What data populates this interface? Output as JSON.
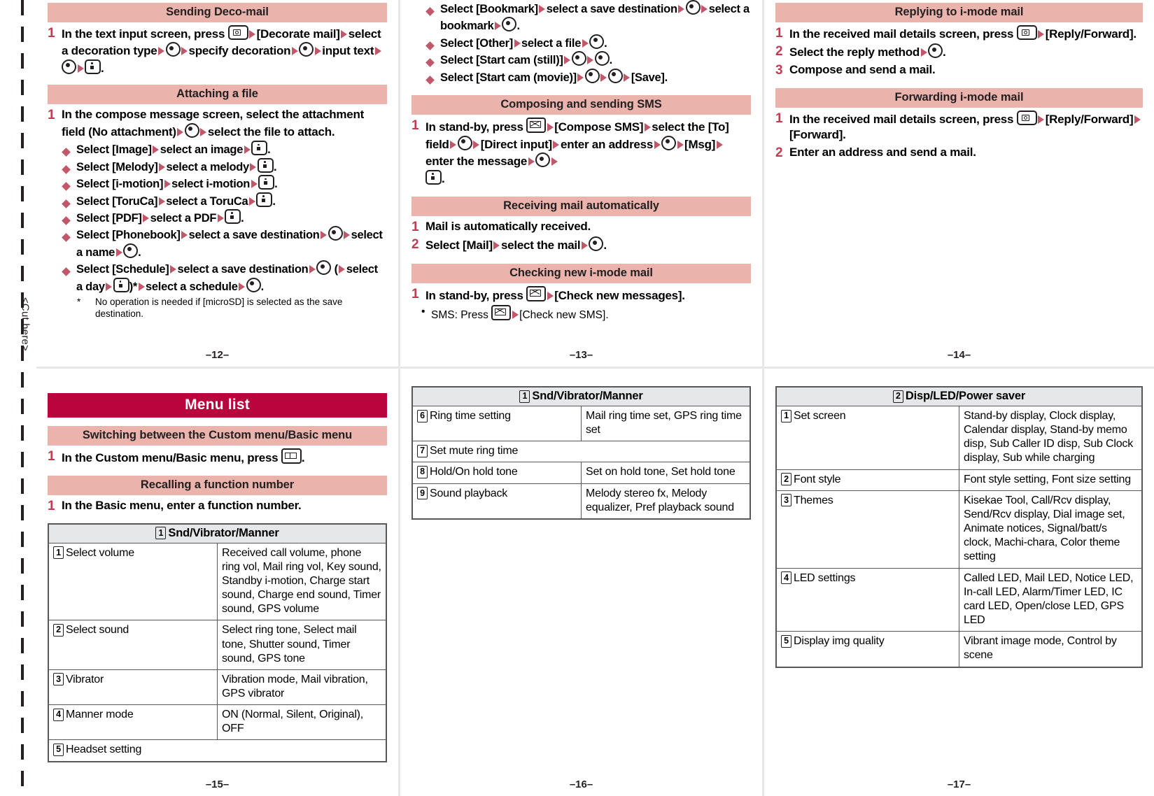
{
  "cut_label": "<Cut here>",
  "icons": {
    "camera_key": "camera-key-icon",
    "i_key": "i-mode-key-icon",
    "mail_key": "mail-key-icon",
    "book_key": "book-key-icon",
    "center_key": "center-select-key-icon",
    "arrow": "arrow-right-icon",
    "diamond": "diamond-bullet-icon"
  },
  "pages": {
    "p12": {
      "folio": "–12–",
      "sections": [
        {
          "title": "Sending Deco-mail",
          "steps": [
            {
              "num": "1",
              "parts": [
                {
                  "t": "In the text input screen, press "
                },
                {
                  "k": "cam"
                },
                {
                  "a": 1
                },
                {
                  "t": "[Decorate mail]"
                },
                {
                  "a": 1
                },
                {
                  "t": "select a decoration type"
                },
                {
                  "a": 1
                },
                {
                  "c": 1
                },
                {
                  "a": 1
                },
                {
                  "t": "specify decoration"
                },
                {
                  "a": 1
                },
                {
                  "c": 1
                },
                {
                  "a": 1
                },
                {
                  "t": "input text"
                },
                {
                  "a": 1
                },
                {
                  "c": 1
                },
                {
                  "a": 1
                },
                {
                  "k": "i"
                },
                {
                  "t": "."
                }
              ]
            }
          ]
        },
        {
          "title": "Attaching a file",
          "steps": [
            {
              "num": "1",
              "parts": [
                {
                  "t": "In the compose message screen, select the attachment field (No attachment)"
                },
                {
                  "a": 1
                },
                {
                  "c": 1
                },
                {
                  "a": 1
                },
                {
                  "t": "select the file to attach."
                }
              ]
            }
          ],
          "bullets": [
            [
              {
                "t": "Select [Image]"
              },
              {
                "a": 1
              },
              {
                "t": "select an image"
              },
              {
                "a": 1
              },
              {
                "k": "i"
              },
              {
                "t": "."
              }
            ],
            [
              {
                "t": "Select [Melody]"
              },
              {
                "a": 1
              },
              {
                "t": "select a melody"
              },
              {
                "a": 1
              },
              {
                "k": "i"
              },
              {
                "t": "."
              }
            ],
            [
              {
                "t": "Select [i-motion]"
              },
              {
                "a": 1
              },
              {
                "t": "select i-motion"
              },
              {
                "a": 1
              },
              {
                "k": "i"
              },
              {
                "t": "."
              }
            ],
            [
              {
                "t": "Select [ToruCa]"
              },
              {
                "a": 1
              },
              {
                "t": "select a ToruCa"
              },
              {
                "a": 1
              },
              {
                "k": "i"
              },
              {
                "t": "."
              }
            ],
            [
              {
                "t": "Select [PDF]"
              },
              {
                "a": 1
              },
              {
                "t": "select a PDF"
              },
              {
                "a": 1
              },
              {
                "k": "i"
              },
              {
                "t": "."
              }
            ],
            [
              {
                "t": "Select [Phonebook]"
              },
              {
                "a": 1
              },
              {
                "t": "select a save destination"
              },
              {
                "a": 1
              },
              {
                "c": 1
              },
              {
                "a": 1
              },
              {
                "t": "select a name"
              },
              {
                "a": 1
              },
              {
                "c": 1
              },
              {
                "t": "."
              }
            ],
            [
              {
                "t": "Select [Schedule]"
              },
              {
                "a": 1
              },
              {
                "t": "select a save destination"
              },
              {
                "a": 1
              },
              {
                "c": 1
              },
              {
                "t": "("
              },
              {
                "a": 1
              },
              {
                "t": "select a day"
              },
              {
                "a": 1
              },
              {
                "k": "i"
              },
              {
                "t": ")*"
              },
              {
                "a": 1
              },
              {
                "t": "select a schedule"
              },
              {
                "a": 1
              },
              {
                "c": 1
              },
              {
                "t": "."
              }
            ]
          ],
          "footnote": {
            "mark": "*",
            "text": "No operation is needed if [microSD] is selected as the save destination."
          }
        }
      ]
    },
    "p13": {
      "folio": "–13–",
      "carryover_bullets": [
        [
          {
            "t": "Select [Bookmark]"
          },
          {
            "a": 1
          },
          {
            "t": "select a save destination"
          },
          {
            "a": 1
          },
          {
            "c": 1
          },
          {
            "a": 1
          },
          {
            "t": "select a bookmark"
          },
          {
            "a": 1
          },
          {
            "c": 1
          },
          {
            "t": "."
          }
        ],
        [
          {
            "t": "Select [Other]"
          },
          {
            "a": 1
          },
          {
            "t": "select a file"
          },
          {
            "a": 1
          },
          {
            "c": 1
          },
          {
            "t": "."
          }
        ],
        [
          {
            "t": "Select [Start cam (still)]"
          },
          {
            "a": 1
          },
          {
            "c": 1
          },
          {
            "a": 1
          },
          {
            "c": 1
          },
          {
            "t": "."
          }
        ],
        [
          {
            "t": "Select [Start cam (movie)]"
          },
          {
            "a": 1
          },
          {
            "c": 1
          },
          {
            "a": 1
          },
          {
            "c": 1
          },
          {
            "a": 1
          },
          {
            "t": "[Save]."
          }
        ]
      ],
      "sections": [
        {
          "title": "Composing and sending SMS",
          "steps": [
            {
              "num": "1",
              "parts": [
                {
                  "t": "In stand-by, press "
                },
                {
                  "k": "mail"
                },
                {
                  "a": 1
                },
                {
                  "t": "[Compose SMS]"
                },
                {
                  "a": 1
                },
                {
                  "t": "select the [To] field"
                },
                {
                  "a": 1
                },
                {
                  "c": 1
                },
                {
                  "a": 1
                },
                {
                  "t": "[Direct input]"
                },
                {
                  "a": 1
                },
                {
                  "t": "enter an address"
                },
                {
                  "a": 1
                },
                {
                  "c": 1
                },
                {
                  "a": 1
                },
                {
                  "t": "[Msg]"
                },
                {
                  "a": 1
                },
                {
                  "t": "enter the message"
                },
                {
                  "a": 1
                },
                {
                  "c": 1
                },
                {
                  "a": 1
                },
                {
                  "k": "i"
                },
                {
                  "t": "."
                }
              ]
            }
          ]
        },
        {
          "title": "Receiving mail automatically",
          "steps": [
            {
              "num": "1",
              "parts": [
                {
                  "t": "Mail is automatically received."
                }
              ]
            },
            {
              "num": "2",
              "parts": [
                {
                  "t": "Select [Mail]"
                },
                {
                  "a": 1
                },
                {
                  "t": "select the mail"
                },
                {
                  "a": 1
                },
                {
                  "c": 1
                },
                {
                  "t": "."
                }
              ]
            }
          ]
        },
        {
          "title": "Checking new i-mode mail",
          "steps": [
            {
              "num": "1",
              "parts": [
                {
                  "t": "In stand-by, press "
                },
                {
                  "k": "mail"
                },
                {
                  "a": 1
                },
                {
                  "t": "[Check new messages]."
                }
              ]
            }
          ],
          "subbullets": [
            [
              {
                "t": "SMS: Press "
              },
              {
                "k": "mail"
              },
              {
                "a": 1
              },
              {
                "t": "[Check new SMS]."
              }
            ]
          ]
        }
      ]
    },
    "p14": {
      "folio": "–14–",
      "sections": [
        {
          "title": "Replying to i-mode mail",
          "steps": [
            {
              "num": "1",
              "parts": [
                {
                  "t": "In the received mail details screen, press "
                },
                {
                  "k": "cam"
                },
                {
                  "a": 1
                },
                {
                  "t": "[Reply/Forward]."
                }
              ]
            },
            {
              "num": "2",
              "parts": [
                {
                  "t": "Select the reply method"
                },
                {
                  "a": 1
                },
                {
                  "c": 1
                },
                {
                  "t": "."
                }
              ]
            },
            {
              "num": "3",
              "parts": [
                {
                  "t": "Compose and send a mail."
                }
              ]
            }
          ]
        },
        {
          "title": "Forwarding i-mode mail",
          "steps": [
            {
              "num": "1",
              "parts": [
                {
                  "t": "In the received mail details screen, press "
                },
                {
                  "k": "cam"
                },
                {
                  "a": 1
                },
                {
                  "t": "[Reply/Forward]"
                },
                {
                  "a": 1
                },
                {
                  "t": "[Forward]."
                }
              ]
            },
            {
              "num": "2",
              "parts": [
                {
                  "t": "Enter an address and send a mail."
                }
              ]
            }
          ]
        }
      ]
    },
    "p15": {
      "folio": "–15–",
      "chapter_title": "Menu list",
      "sections": [
        {
          "title": "Switching between the Custom menu/Basic menu",
          "steps": [
            {
              "num": "1",
              "parts": [
                {
                  "t": "In the Custom menu/Basic menu, press "
                },
                {
                  "k": "book"
                },
                {
                  "t": "."
                }
              ]
            }
          ]
        },
        {
          "title": "Recalling a function number",
          "steps": [
            {
              "num": "1",
              "parts": [
                {
                  "t": "In the Basic menu, enter a function number."
                }
              ]
            }
          ]
        }
      ],
      "table": {
        "header_num": "1",
        "header_label": "Snd/Vibrator/Manner",
        "rows": [
          {
            "num": "1",
            "key": "Select volume",
            "value": "Received call volume, phone ring vol, Mail ring vol, Key sound, Standby i-motion, Charge start sound, Charge end sound, Timer sound, GPS volume"
          },
          {
            "num": "2",
            "key": "Select sound",
            "value": "Select ring tone, Select mail tone, Shutter sound, Timer sound, GPS tone"
          },
          {
            "num": "3",
            "key": "Vibrator",
            "value": "Vibration mode, Mail vibration, GPS vibrator"
          },
          {
            "num": "4",
            "key": "Manner mode",
            "value": "ON (Normal, Silent, Original), OFF"
          },
          {
            "num": "5",
            "key": "Headset setting",
            "value": "",
            "span": true
          }
        ]
      }
    },
    "p16": {
      "folio": "–16–",
      "table": {
        "header_num": "1",
        "header_label": "Snd/Vibrator/Manner",
        "rows": [
          {
            "num": "6",
            "key": "Ring time setting",
            "value": "Mail ring time set, GPS ring time set"
          },
          {
            "num": "7",
            "key": "Set mute ring time",
            "value": "",
            "span": true
          },
          {
            "num": "8",
            "key": "Hold/On hold tone",
            "value": "Set on hold tone, Set hold tone"
          },
          {
            "num": "9",
            "key": "Sound playback",
            "value": "Melody stereo fx, Melody equalizer, Pref playback sound"
          }
        ]
      }
    },
    "p17": {
      "folio": "–17–",
      "table": {
        "header_num": "2",
        "header_label": "Disp/LED/Power saver",
        "rows": [
          {
            "num": "1",
            "key": "Set screen",
            "value": "Stand-by display, Clock display, Calendar display, Stand-by memo disp, Sub Caller ID disp, Sub Clock display, Sub while charging"
          },
          {
            "num": "2",
            "key": "Font style",
            "value": "Font style setting, Font size setting"
          },
          {
            "num": "3",
            "key": "Themes",
            "value": "Kisekae Tool, Call/Rcv display, Send/Rcv display, Dial image set, Animate notices, Signal/batt/s clock, Machi-chara, Color theme setting"
          },
          {
            "num": "4",
            "key": "LED settings",
            "value": "Called LED, Mail LED, Notice LED, In-call LED, Alarm/Timer LED, IC card LED, Open/close LED, GPS LED"
          },
          {
            "num": "5",
            "key": "Display img quality",
            "value": "Vibrant image mode, Control by scene"
          }
        ]
      }
    }
  }
}
